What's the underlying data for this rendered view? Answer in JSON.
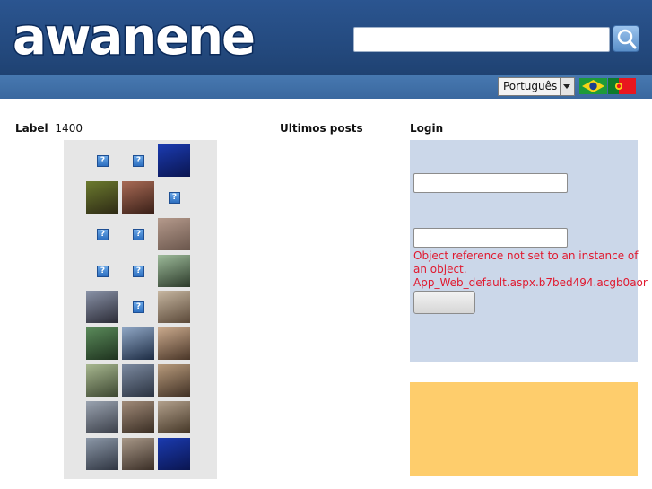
{
  "header": {
    "logo_text": "awanene",
    "search": {
      "value": "",
      "placeholder": ""
    },
    "search_button_icon": "magnifier-icon"
  },
  "language_bar": {
    "selected_language": "Português",
    "flags": [
      "brazil-flag-icon",
      "portugal-flag-icon"
    ]
  },
  "left_column": {
    "label": "Label",
    "count": "1400",
    "gallery_rows": 9
  },
  "middle_column": {
    "title": "Ultimos posts"
  },
  "login": {
    "title": "Login",
    "username_value": "",
    "password_value": "",
    "error_message": "Object reference not set to an instance of an object. App_Web_default.aspx.b7bed494.acgb0aor",
    "submit_label": ""
  },
  "colors": {
    "header_bg": "#24497c",
    "bar_bg": "#4170a8",
    "login_bg": "#cbd7e9",
    "ad_bg": "#fecd6c",
    "error_text": "#e0192f"
  }
}
